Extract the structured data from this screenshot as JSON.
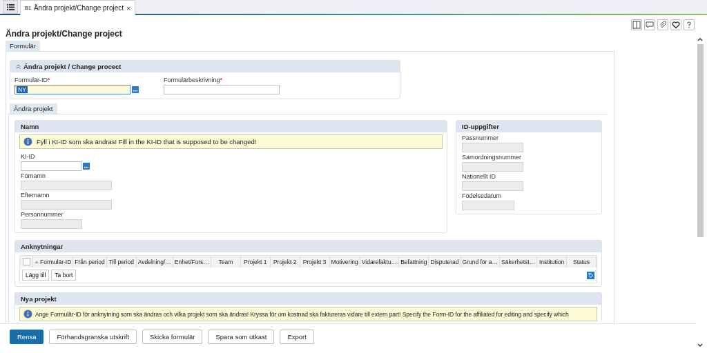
{
  "tabs": [
    {
      "badge": "B1",
      "label": "Ändra projekt/Change project",
      "close": "×",
      "selected": true
    }
  ],
  "title": "Ändra projekt/Change project",
  "form_tab": {
    "label": "Formulär",
    "selected": true
  },
  "header_panel": {
    "title": "Ändra projekt / Change procect",
    "expanded": true,
    "fields": [
      {
        "label": "Formulär-ID",
        "required_mark": "*",
        "kind": "lookup",
        "value": "NY",
        "focused": true
      },
      {
        "label": "Formulärbeskrivning",
        "required_mark": "*",
        "kind": "text",
        "focused": false
      }
    ]
  },
  "section_tab": {
    "label": "Ändra projekt",
    "selected": true
  },
  "namn_panel": {
    "title": "Namn",
    "info": "Fyll i KI-ID som ska ändras! Fill in the KI-ID that is supposed to be changed!",
    "fields": [
      {
        "label": "KI-ID",
        "kind": "lookup",
        "disabled": false
      },
      {
        "label": "Förnamn",
        "kind": "text",
        "disabled": true
      },
      {
        "label": "Efternamn",
        "kind": "text",
        "disabled": true
      },
      {
        "label": "Personnummer",
        "kind": "text",
        "disabled": true
      }
    ]
  },
  "id_panel": {
    "title": "ID-uppgifter",
    "fields": [
      {
        "label": "Passnummer",
        "disabled": true
      },
      {
        "label": "Samordningsnummer",
        "disabled": true
      },
      {
        "label": "Nationellt ID",
        "disabled": true
      },
      {
        "label": "Födelsedatum",
        "disabled": true
      }
    ]
  },
  "anknytningar": {
    "title": "Anknytningar",
    "select_all": false,
    "columns": [
      {
        "label": "Formulär-ID",
        "sorted": true
      },
      {
        "label": "Från period",
        "sorted": false
      },
      {
        "label": "Till period",
        "sorted": false
      },
      {
        "label": "Avdelning/…",
        "sorted": false
      },
      {
        "label": "Enhet/Fors…",
        "sorted": false
      },
      {
        "label": "Team",
        "sorted": false
      },
      {
        "label": "Projekt 1",
        "sorted": false
      },
      {
        "label": "Projekt 2",
        "sorted": false
      },
      {
        "label": "Projekt 3",
        "sorted": false
      },
      {
        "label": "Motivering",
        "sorted": false
      },
      {
        "label": "Vidarefaktu…",
        "sorted": false
      },
      {
        "label": "Befattning",
        "sorted": false
      },
      {
        "label": "Disputerad",
        "sorted": false
      },
      {
        "label": "Grund för a…",
        "sorted": false
      },
      {
        "label": "Säkerhetst…",
        "sorted": false
      },
      {
        "label": "Institution",
        "sorted": false
      },
      {
        "label": "Status",
        "sorted": false
      }
    ],
    "buttons": [
      "Lägg till",
      "Ta bort"
    ]
  },
  "nya_projekt": {
    "title": "Nya projekt",
    "info": "Ange Formulär-ID för anknytning som ska ändras och vilka projekt som ska ändras! Kryssa för om kostnad ska faktureras vidare till extern part! Specify the Form-ID for the affiliated for editing and specify which"
  },
  "footer_buttons": [
    {
      "label": "Rensa",
      "primary": true
    },
    {
      "label": "Förhandsgranska utskrift",
      "primary": false
    },
    {
      "label": "Skicka formulär",
      "primary": false
    },
    {
      "label": "Spara som utkast",
      "primary": false
    },
    {
      "label": "Export",
      "primary": false
    }
  ]
}
